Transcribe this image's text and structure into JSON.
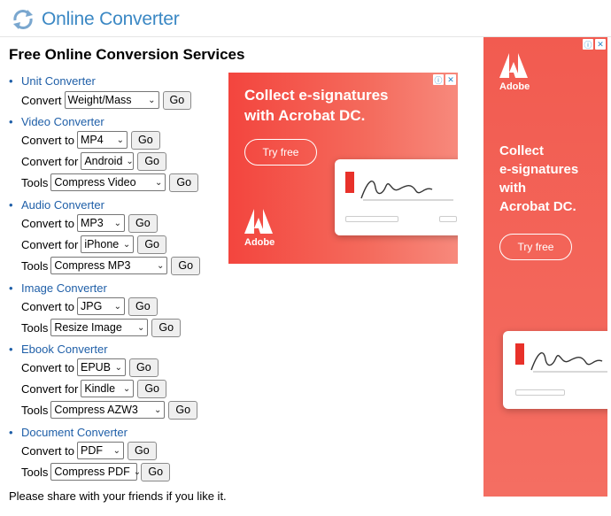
{
  "header": {
    "site_title": "Online Converter"
  },
  "page_title": "Free Online Conversion Services",
  "sections": {
    "unit": {
      "link": "Unit Converter",
      "rows": [
        {
          "label": "Convert",
          "select": "Weight/Mass",
          "button": "Go"
        }
      ]
    },
    "video": {
      "link": "Video Converter",
      "rows": [
        {
          "label": "Convert to",
          "select": "MP4",
          "button": "Go"
        },
        {
          "label": "Convert for",
          "select": "Android",
          "button": "Go"
        },
        {
          "label": "Tools",
          "select": "Compress Video",
          "button": "Go"
        }
      ]
    },
    "audio": {
      "link": "Audio Converter",
      "rows": [
        {
          "label": "Convert to",
          "select": "MP3",
          "button": "Go"
        },
        {
          "label": "Convert for",
          "select": "iPhone",
          "button": "Go"
        },
        {
          "label": "Tools",
          "select": "Compress MP3",
          "button": "Go"
        }
      ]
    },
    "image": {
      "link": "Image Converter",
      "rows": [
        {
          "label": "Convert to",
          "select": "JPG",
          "button": "Go"
        },
        {
          "label": "Tools",
          "select": "Resize Image",
          "button": "Go"
        }
      ]
    },
    "ebook": {
      "link": "Ebook Converter",
      "rows": [
        {
          "label": "Convert to",
          "select": "EPUB",
          "button": "Go"
        },
        {
          "label": "Convert for",
          "select": "Kindle",
          "button": "Go"
        },
        {
          "label": "Tools",
          "select": "Compress AZW3",
          "button": "Go"
        }
      ]
    },
    "document": {
      "link": "Document Converter",
      "rows": [
        {
          "label": "Convert to",
          "select": "PDF",
          "button": "Go"
        },
        {
          "label": "Tools",
          "select": "Compress PDF",
          "button": "Go"
        }
      ]
    }
  },
  "footer_text": "Please share with your friends if you like it.",
  "ads": {
    "banner": {
      "headline_1": "Collect e-signatures",
      "headline_2": "with Acrobat DC.",
      "cta": "Try free",
      "brand": "Adobe"
    },
    "skyscraper": {
      "brand": "Adobe",
      "headline_1": "Collect",
      "headline_2": "e-signatures",
      "headline_3": "with",
      "headline_4": "Acrobat DC.",
      "cta": "Try free"
    }
  },
  "colors": {
    "link": "#1f5fa8",
    "title": "#3b88c4",
    "ad_red": "#f3453e"
  }
}
